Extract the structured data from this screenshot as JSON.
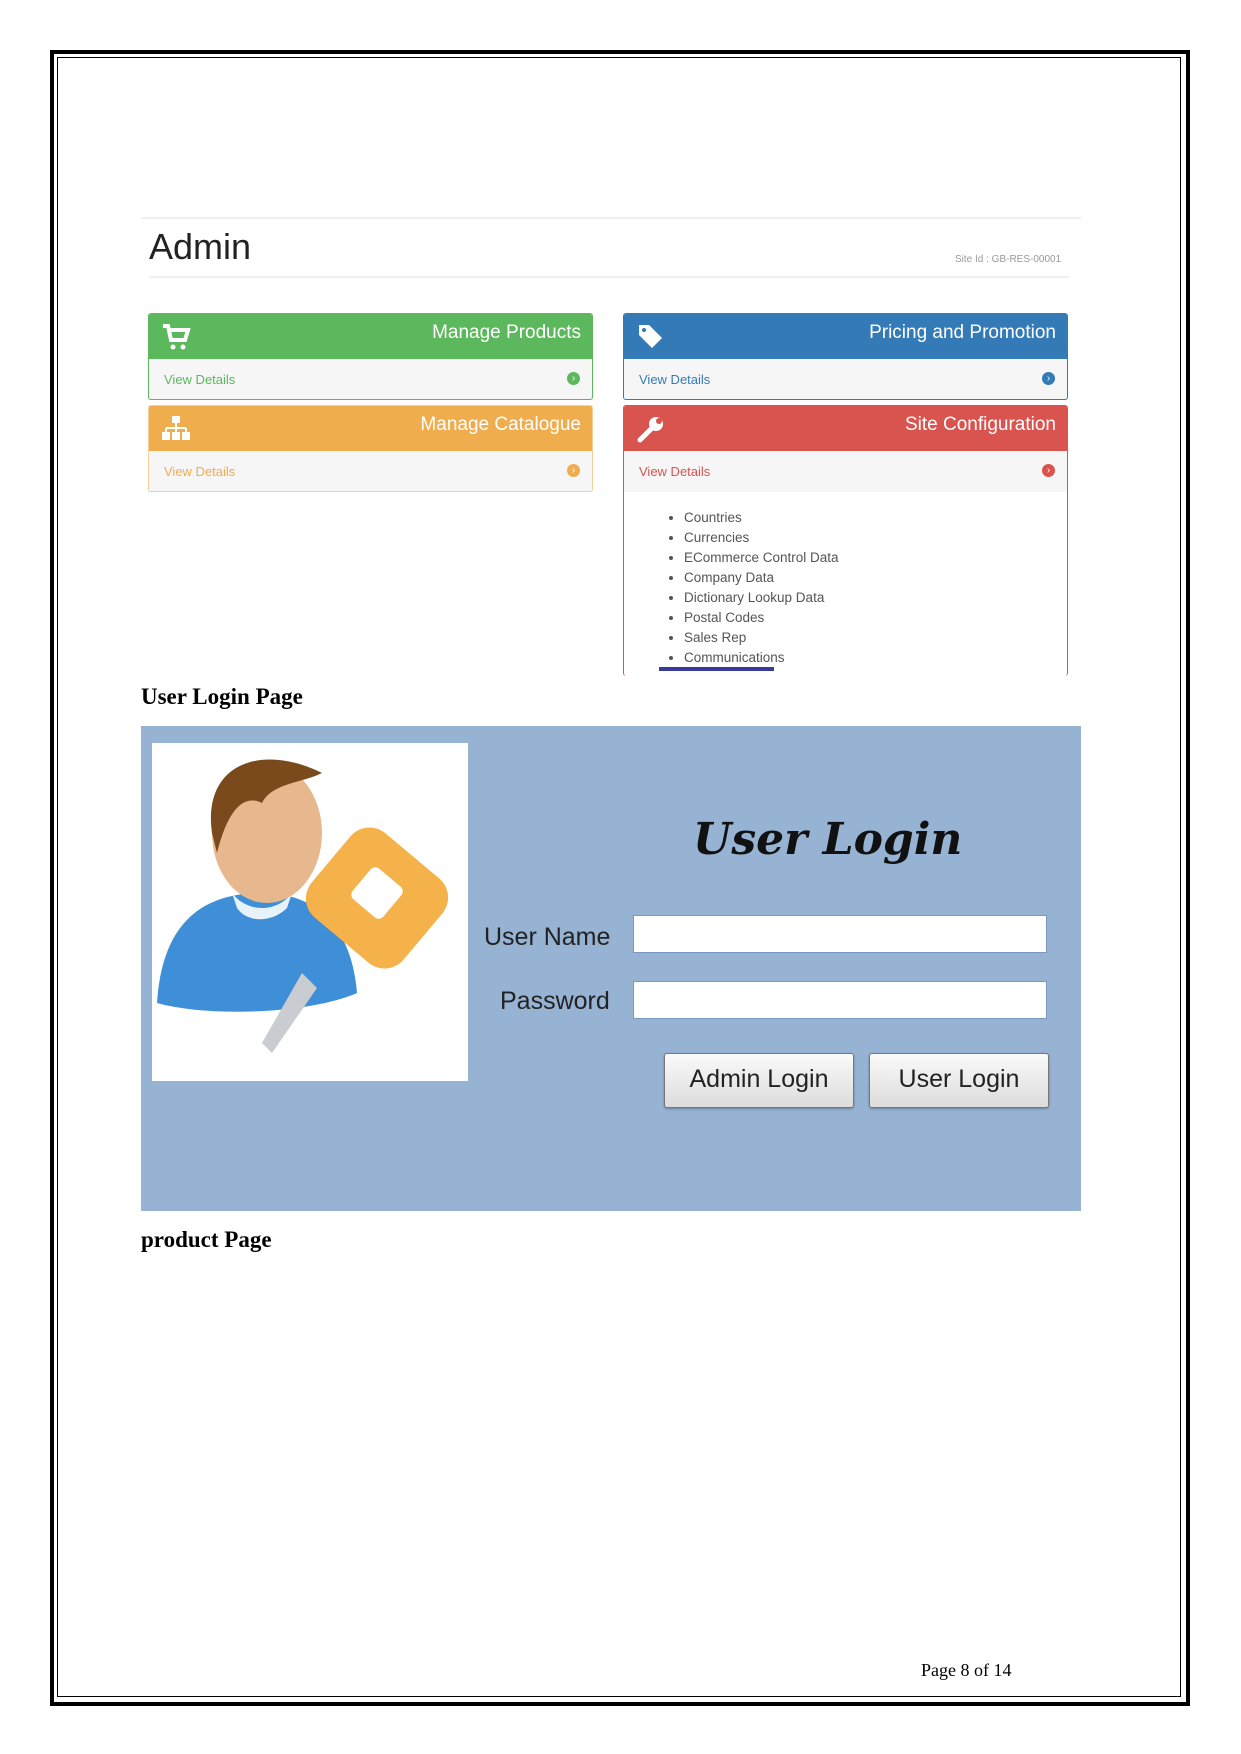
{
  "admin": {
    "title": "Admin",
    "site_id": "Site Id : GB-RES-00001",
    "panels": [
      {
        "title": "Manage Products",
        "link": "View Details",
        "icon": "shopping-cart-icon",
        "color": "#5cb85c"
      },
      {
        "title": "Pricing and Promotion",
        "link": "View Details",
        "icon": "tags-icon",
        "color": "#337ab7"
      },
      {
        "title": "Manage Catalogue",
        "link": "View Details",
        "icon": "sitemap-icon",
        "color": "#f0ad4e"
      },
      {
        "title": "Site Configuration",
        "link": "View Details",
        "icon": "wrench-icon",
        "color": "#d9534f"
      }
    ],
    "site_config_items": [
      "Countries",
      "Currencies",
      "ECommerce Control Data",
      "Company Data",
      "Dictionary Lookup Data",
      "Postal Codes",
      "Sales Rep",
      "Communications"
    ]
  },
  "sections": {
    "user_login": "User Login Page",
    "product": "product Page"
  },
  "login": {
    "title": "User Login",
    "username_label": "User Name",
    "username_value": "",
    "password_label": "Password",
    "password_value": "",
    "admin_button": "Admin Login",
    "user_button": "User Login",
    "background": "#97b3d3"
  },
  "footer": {
    "page": "Page 8 of 14"
  }
}
